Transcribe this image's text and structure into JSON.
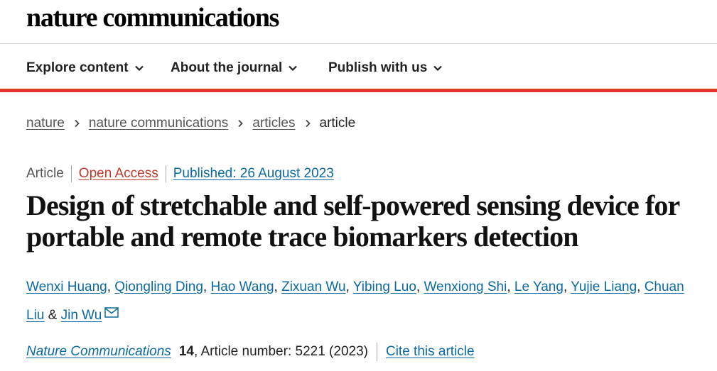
{
  "site": {
    "logo_text": "nature communications"
  },
  "nav": {
    "items": [
      {
        "label": "Explore content"
      },
      {
        "label": "About the journal"
      },
      {
        "label": "Publish with us"
      }
    ]
  },
  "breadcrumb": {
    "items": [
      "nature",
      "nature communications",
      "articles"
    ],
    "current": "article"
  },
  "article": {
    "type": "Article",
    "access": "Open Access",
    "published": "Published: 26 August 2023",
    "title": "Design of stretchable and self-powered sensing device for portable and remote trace biomarkers detection",
    "authors": [
      "Wenxi Huang",
      "Qiongling Ding",
      "Hao Wang",
      "Zixuan Wu",
      "Yibing Luo",
      "Wenxiong Shi",
      "Le Yang",
      "Yujie Liang",
      "Chuan Liu",
      "Jin Wu"
    ],
    "author_separator": ", ",
    "author_conjunction": " & ",
    "journal": "Nature Communications",
    "volume": "14",
    "article_number": ", Article number: 5221 (2023)",
    "cite_label": "Cite this article"
  },
  "colors": {
    "accent_red": "#e0372a",
    "link_blue": "#0a6aa1",
    "open_access": "#c0392b"
  },
  "icons": {
    "nav_chevron": "chevron-down-icon",
    "breadcrumb_separator": "chevron-right-icon",
    "corresponding_author": "mail-icon"
  }
}
